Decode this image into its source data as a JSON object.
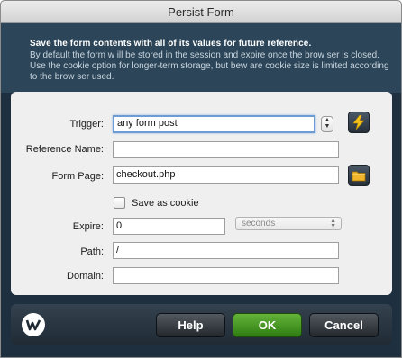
{
  "window": {
    "title": "Persist Form"
  },
  "banner": {
    "headline": "Save the form contents with all of its values for future reference.",
    "description": "By default the form w ill be stored in the session and expire once the brow ser is closed. Use the cookie option for longer-term storage, but bew are cookie size is limited according to the brow ser used."
  },
  "form": {
    "trigger": {
      "label": "Trigger:",
      "value": "any form post"
    },
    "reference_name": {
      "label": "Reference Name:",
      "value": ""
    },
    "form_page": {
      "label": "Form Page:",
      "value": "checkout.php"
    },
    "save_as_cookie": {
      "label": "Save as cookie",
      "checked": false
    },
    "expire": {
      "label": "Expire:",
      "value": "0",
      "unit": "seconds"
    },
    "path": {
      "label": "Path:",
      "value": "/"
    },
    "domain": {
      "label": "Domain:",
      "value": ""
    }
  },
  "icons": {
    "trigger_action": "lightning-icon",
    "browse": "folder-icon",
    "logo": "app-logo-icon",
    "stepper": "stepper-arrows-icon"
  },
  "buttons": {
    "help": "Help",
    "ok": "OK",
    "cancel": "Cancel"
  },
  "colors": {
    "accent_ok": "#4a9a25",
    "banner": "#2c4558",
    "focus": "#6d9bd4",
    "lightning": "#f3c21a",
    "folder": "#f0b52a"
  }
}
